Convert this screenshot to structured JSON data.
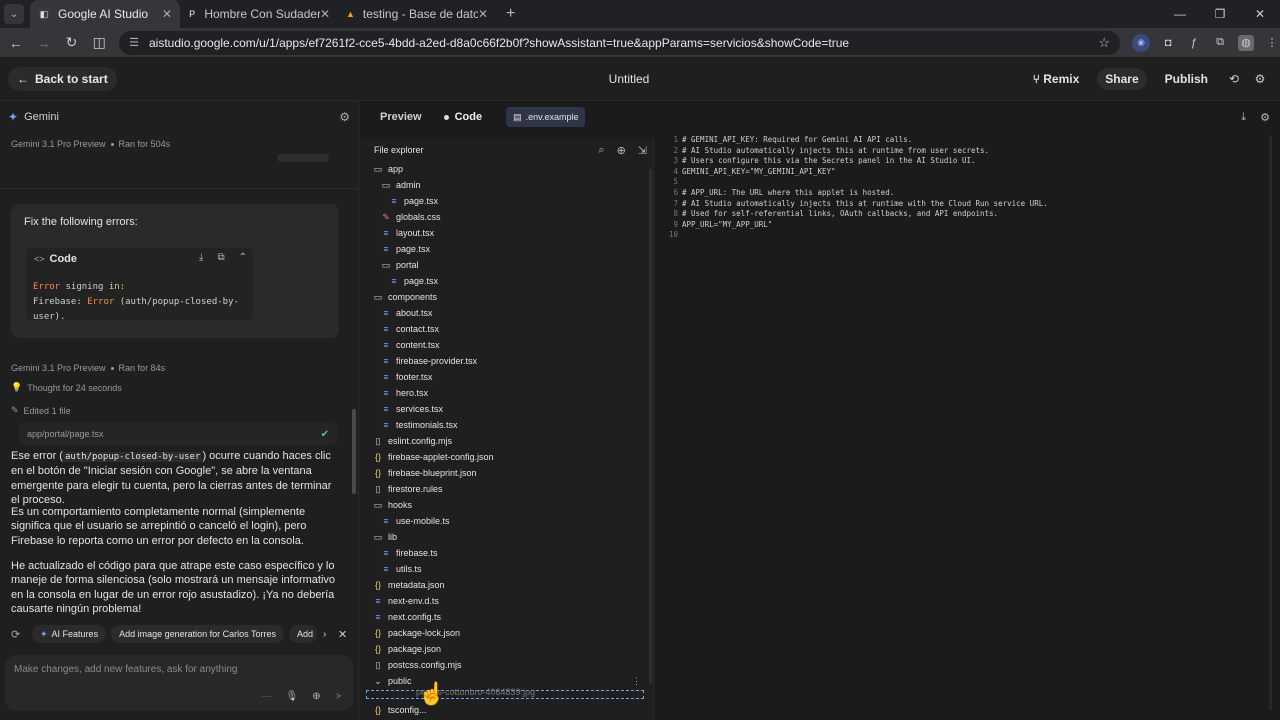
{
  "browser": {
    "tabs": [
      {
        "label": "Google AI Studio",
        "icon": "aistudio-icon",
        "active": true
      },
      {
        "label": "Hombre Con Sudadera Negra I",
        "icon": "pexels-icon",
        "active": false
      },
      {
        "label": "testing - Base de datos - Datos",
        "icon": "firebase-icon",
        "active": false
      }
    ],
    "url": "aistudio.google.com/u/1/apps/ef7261f2-cce5-4bdd-a2ed-d8a0c66f2b0f?showAssistant=true&appParams=servicios&showCode=true"
  },
  "header": {
    "back_label": "Back to start",
    "title": "Untitled",
    "remix_label": "Remix",
    "share_label": "Share",
    "publish_label": "Publish"
  },
  "chat": {
    "assistant_name": "Gemini",
    "run1": {
      "model": "Gemini 3.1 Pro Preview",
      "ran": "Ran for 504s"
    },
    "user_prompt": "Fix the following errors:",
    "code_title": "Code",
    "code_line1_a": "Error",
    "code_line1_b": " signing ",
    "code_line1_c": "in",
    "code_line1_d": ":",
    "code_line2_a": "Firebase: ",
    "code_line2_b": "Error",
    "code_line2_c": " (auth/popup-closed-by-user).",
    "run2": {
      "model": "Gemini 3.1 Pro Preview",
      "ran": "Ran for 84s"
    },
    "thought": "Thought for 24 seconds",
    "edited": "Edited 1 file",
    "edited_file": "app/portal/page.tsx",
    "p1_a": "Ese error (",
    "p1_code": "auth/popup-closed-by-user",
    "p1_b": ") ocurre cuando haces clic en el botón de \"Iniciar sesión con Google\", se abre la ventana emergente para elegir tu cuenta, pero la cierras antes de terminar el proceso.",
    "p2": "Es un comportamiento completamente normal (simplemente significa que el usuario se arrepintió o canceló el login), pero Firebase lo reporta como un error por defecto en la consola.",
    "p3": "He actualizado el código para que atrape este caso específico y lo maneje de forma silenciosa (solo mostrará un mensaje informativo en la consola en lugar de un error rojo asustadizo). ¡Ya no debería causarte ningún problema!",
    "chips": [
      "AI Features",
      "Add image generation for Carlos Torres",
      "Add"
    ],
    "input_placeholder": "Make changes, add new features, ask for anything"
  },
  "code": {
    "tab_preview": "Preview",
    "tab_code": "Code",
    "open_file": ".env.example",
    "explorer_title": "File explorer",
    "tree": [
      {
        "name": "app",
        "kind": "folder",
        "depth": 0
      },
      {
        "name": "admin",
        "kind": "folder",
        "depth": 1
      },
      {
        "name": "page.tsx",
        "kind": "file",
        "depth": 2
      },
      {
        "name": "globals.css",
        "kind": "css",
        "depth": 1
      },
      {
        "name": "layout.tsx",
        "kind": "file",
        "depth": 1
      },
      {
        "name": "page.tsx",
        "kind": "file",
        "depth": 1
      },
      {
        "name": "portal",
        "kind": "folder",
        "depth": 1
      },
      {
        "name": "page.tsx",
        "kind": "file",
        "depth": 2
      },
      {
        "name": "components",
        "kind": "folder",
        "depth": 0
      },
      {
        "name": "about.tsx",
        "kind": "file",
        "depth": 1
      },
      {
        "name": "contact.tsx",
        "kind": "file",
        "depth": 1
      },
      {
        "name": "content.tsx",
        "kind": "file",
        "depth": 1
      },
      {
        "name": "firebase-provider.tsx",
        "kind": "file",
        "depth": 1
      },
      {
        "name": "footer.tsx",
        "kind": "file",
        "depth": 1
      },
      {
        "name": "hero.tsx",
        "kind": "file",
        "depth": 1
      },
      {
        "name": "services.tsx",
        "kind": "file",
        "depth": 1
      },
      {
        "name": "testimonials.tsx",
        "kind": "file",
        "depth": 1
      },
      {
        "name": "eslint.config.mjs",
        "kind": "plain",
        "depth": 0
      },
      {
        "name": "firebase-applet-config.json",
        "kind": "json",
        "depth": 0
      },
      {
        "name": "firebase-blueprint.json",
        "kind": "json",
        "depth": 0
      },
      {
        "name": "firestore.rules",
        "kind": "plain",
        "depth": 0
      },
      {
        "name": "hooks",
        "kind": "folder",
        "depth": 0
      },
      {
        "name": "use-mobile.ts",
        "kind": "file",
        "depth": 1
      },
      {
        "name": "lib",
        "kind": "folder",
        "depth": 0
      },
      {
        "name": "firebase.ts",
        "kind": "file",
        "depth": 1
      },
      {
        "name": "utils.ts",
        "kind": "file",
        "depth": 1
      },
      {
        "name": "metadata.json",
        "kind": "json",
        "depth": 0
      },
      {
        "name": "next-env.d.ts",
        "kind": "file",
        "depth": 0
      },
      {
        "name": "next.config.ts",
        "kind": "file",
        "depth": 0
      },
      {
        "name": "package-lock.json",
        "kind": "json",
        "depth": 0
      },
      {
        "name": "package.json",
        "kind": "json",
        "depth": 0
      },
      {
        "name": "postcss.config.mjs",
        "kind": "plain",
        "depth": 0
      },
      {
        "name": "public",
        "kind": "open-folder",
        "depth": 0
      },
      {
        "name": "tsconfig...",
        "kind": "json",
        "depth": 0
      }
    ],
    "dragging_file": "pexels-cottonbro-4064839.jpg",
    "lines": [
      "# GEMINI_API_KEY: Required for Gemini AI API calls.",
      "# AI Studio automatically injects this at runtime from user secrets.",
      "# Users configure this via the Secrets panel in the AI Studio UI.",
      "GEMINI_API_KEY=\"MY_GEMINI_API_KEY\"",
      "",
      "# APP_URL: The URL where this applet is hosted.",
      "# AI Studio automatically injects this at runtime with the Cloud Run service URL.",
      "# Used for self-referential links, OAuth callbacks, and API endpoints.",
      "APP_URL=\"MY_APP_URL\"",
      ""
    ]
  }
}
